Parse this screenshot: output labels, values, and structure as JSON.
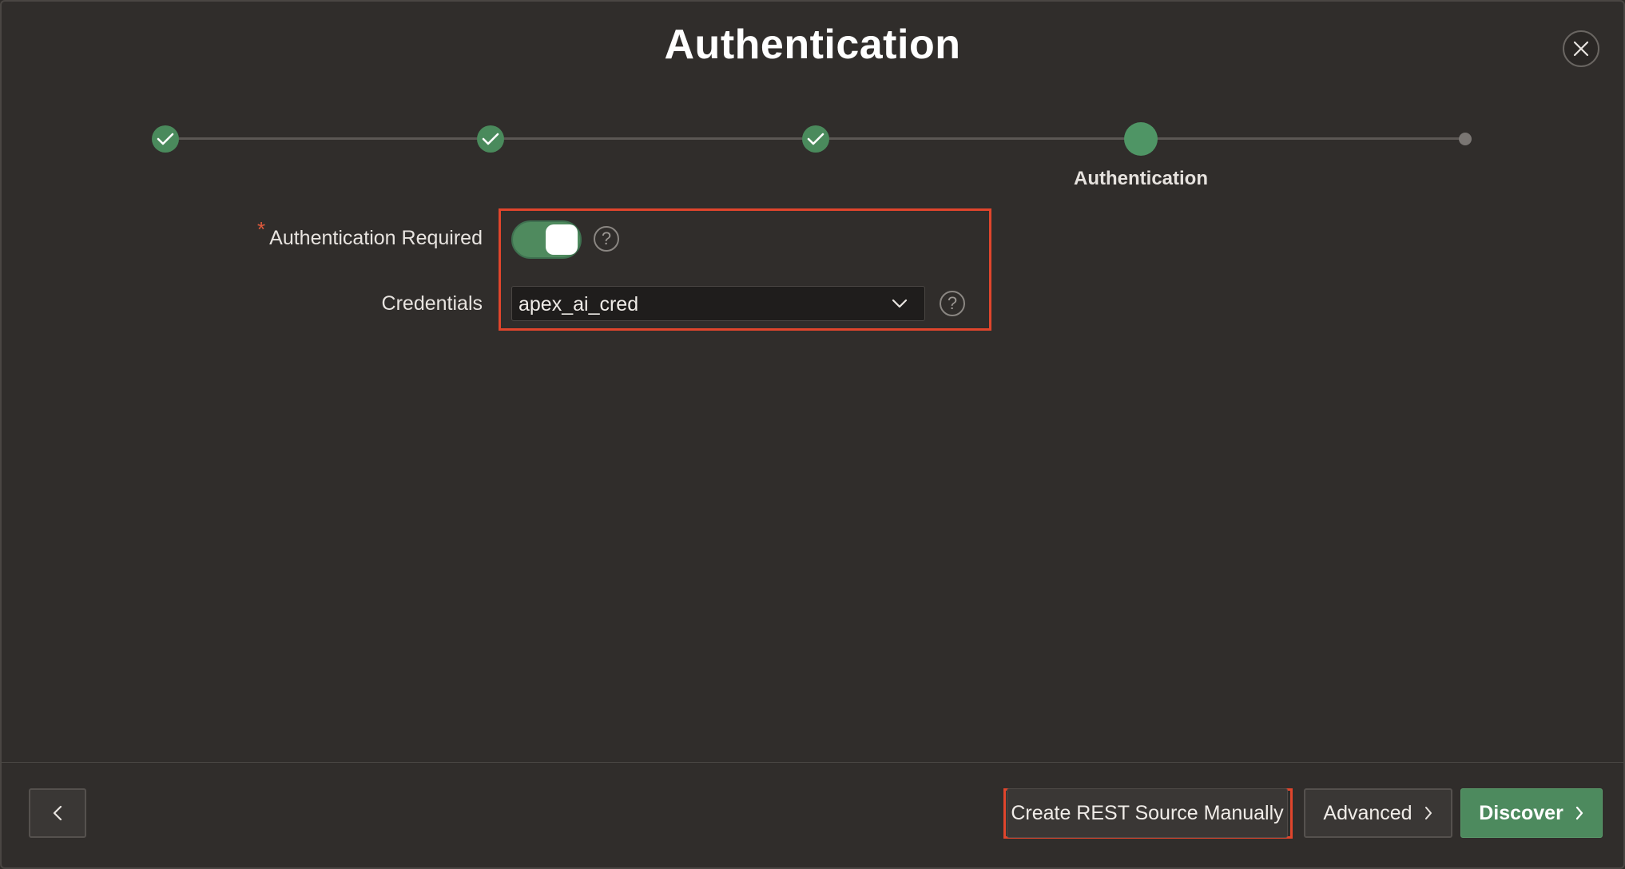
{
  "dialog": {
    "title": "Authentication",
    "close_icon": "close-icon"
  },
  "tracker": {
    "steps": [
      {
        "state": "done",
        "icon": "check-icon"
      },
      {
        "state": "done",
        "icon": "check-icon"
      },
      {
        "state": "done",
        "icon": "check-icon"
      },
      {
        "state": "current",
        "label": "Authentication"
      },
      {
        "state": "future"
      }
    ]
  },
  "form": {
    "auth_required": {
      "label": "Authentication Required",
      "required_marker": "*",
      "value": "on",
      "help": "?"
    },
    "credentials": {
      "label": "Credentials",
      "value": "apex_ai_cred",
      "help": "?"
    }
  },
  "footer": {
    "back_icon": "chevron-left-icon",
    "create_label": "Create REST Source Manually",
    "advanced_label": "Advanced",
    "discover_label": "Discover"
  },
  "colors": {
    "accent_green": "#4d8a5e",
    "highlight_red": "#e0452c",
    "background": "#302d2b"
  }
}
